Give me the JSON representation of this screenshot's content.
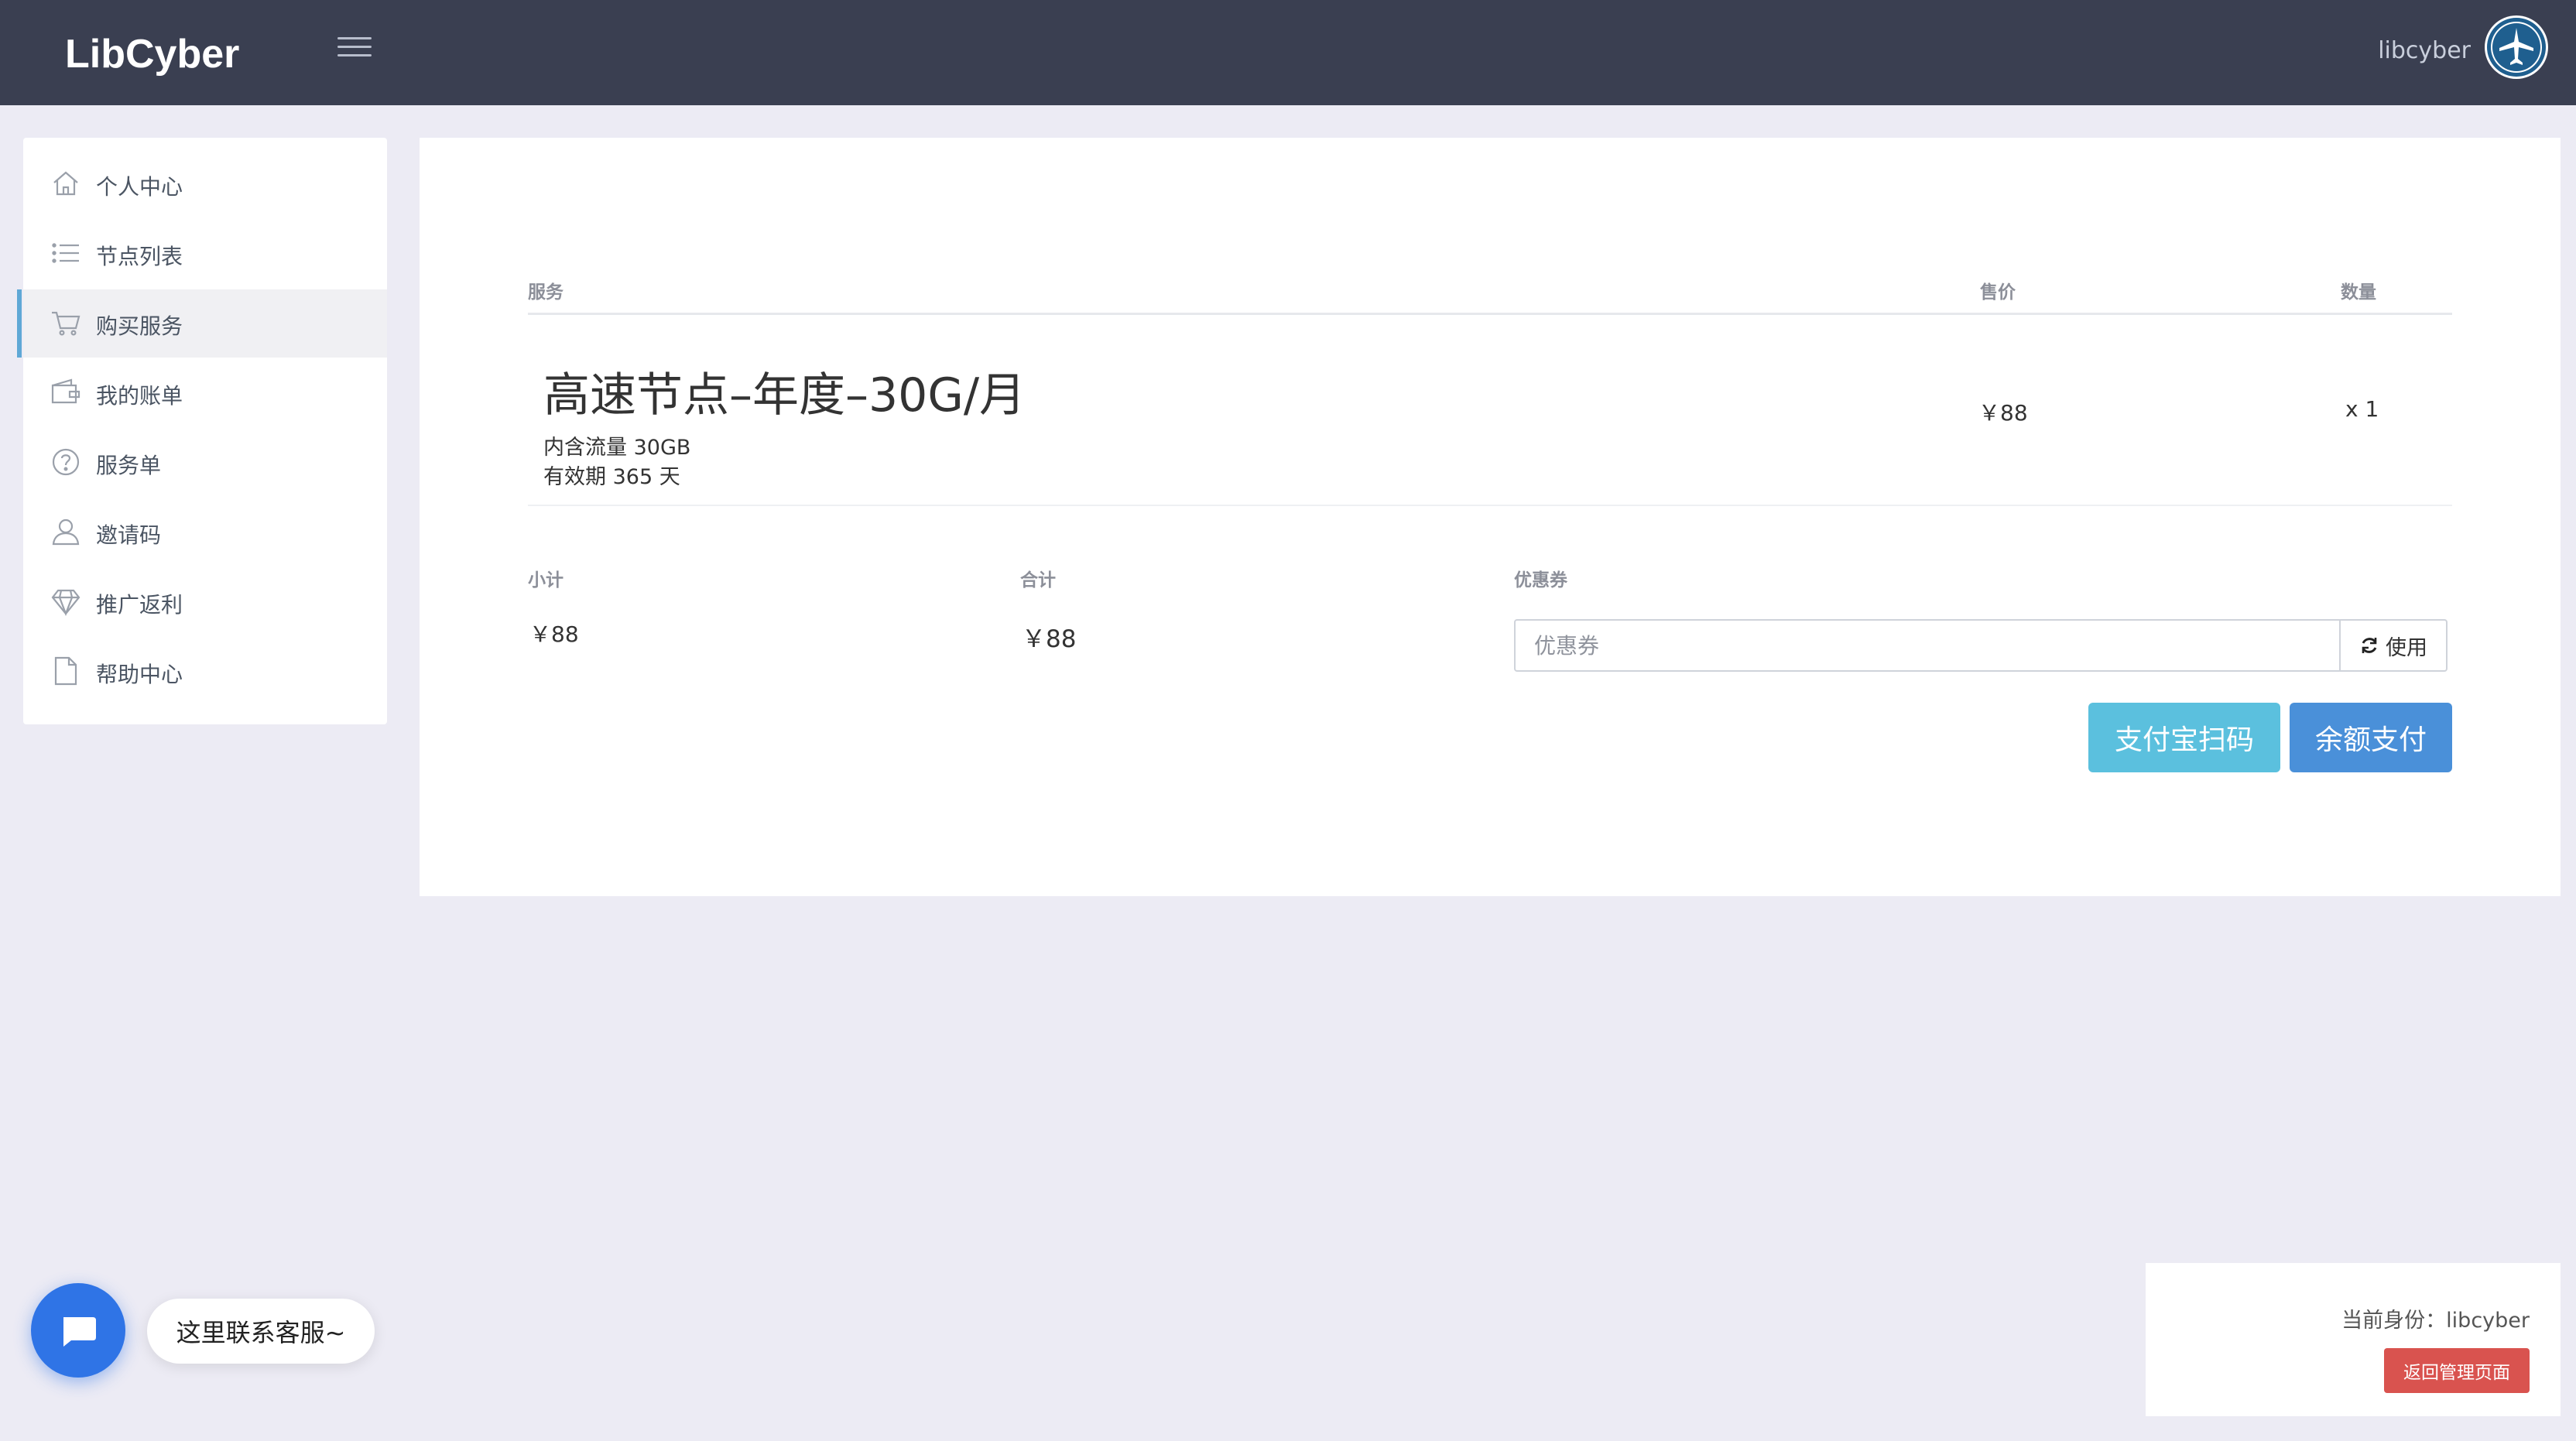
{
  "header": {
    "brand": "LibCyber",
    "menu_icon": "hamburger-icon",
    "username": "libcyber",
    "avatar_icon": "airplane-icon"
  },
  "sidebar": {
    "items": [
      {
        "label": "个人中心",
        "icon": "home-icon",
        "active": false
      },
      {
        "label": "节点列表",
        "icon": "list-icon",
        "active": false
      },
      {
        "label": "购买服务",
        "icon": "cart-icon",
        "active": true
      },
      {
        "label": "我的账单",
        "icon": "wallet-icon",
        "active": false
      },
      {
        "label": "服务单",
        "icon": "help-circle-icon",
        "active": false
      },
      {
        "label": "邀请码",
        "icon": "user-icon",
        "active": false
      },
      {
        "label": "推广返利",
        "icon": "diamond-icon",
        "active": false
      },
      {
        "label": "帮助中心",
        "icon": "file-icon",
        "active": false
      }
    ]
  },
  "order": {
    "headers": {
      "service": "服务",
      "price": "售价",
      "quantity": "数量"
    },
    "product": {
      "name": "高速节点–年度–30G/月",
      "traffic": "内含流量 30GB",
      "validity": "有效期 365 天",
      "price": "￥88",
      "quantity": "x 1"
    },
    "summary": {
      "subtotal_label": "小计",
      "subtotal": "￥88",
      "total_label": "合计",
      "total": "￥88",
      "coupon_label": "优惠券",
      "coupon_placeholder": "优惠券",
      "coupon_value": "",
      "apply_label": "使用",
      "apply_icon": "refresh-icon"
    },
    "buttons": {
      "alipay": "支付宝扫码",
      "balance": "余额支付"
    }
  },
  "chat": {
    "icon": "chat-icon",
    "tip": "这里联系客服~"
  },
  "identity": {
    "text": "当前身份：libcyber",
    "back_button": "返回管理页面"
  },
  "colors": {
    "topbar": "#3a3f51",
    "page_bg": "#ecebf4",
    "active_accent": "#5fa8d6",
    "alipay_button": "#5bc0de",
    "balance_button": "#4a90d9",
    "back_button": "#d9534f",
    "chat_button": "#2f74e6"
  }
}
